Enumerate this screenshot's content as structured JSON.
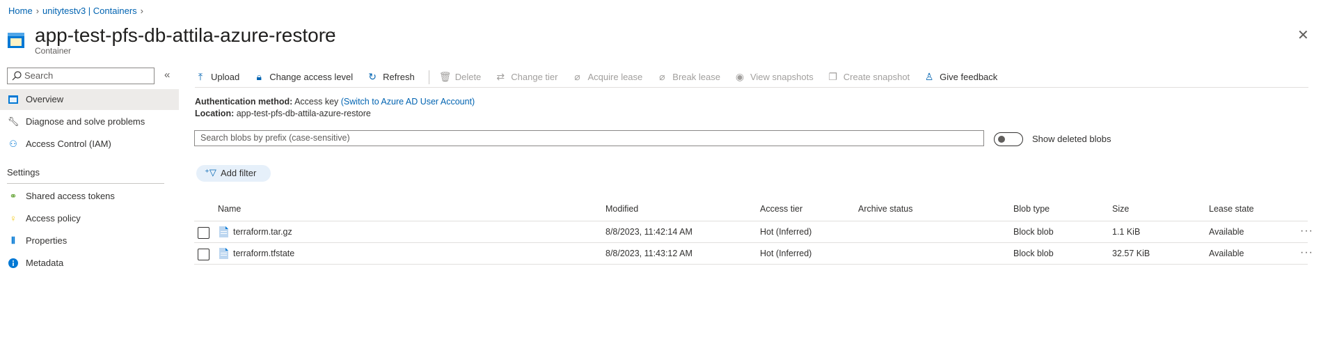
{
  "breadcrumb": [
    "Home",
    "unitytestv3 | Containers"
  ],
  "header": {
    "title": "app-test-pfs-db-attila-azure-restore",
    "subtitle": "Container",
    "more": "···",
    "close": "✕"
  },
  "sidebar": {
    "search_placeholder": "Search",
    "collapse": "«",
    "items": [
      {
        "label": "Overview",
        "icon": "container-icon"
      },
      {
        "label": "Diagnose and solve problems",
        "icon": "wrench-icon"
      },
      {
        "label": "Access Control (IAM)",
        "icon": "people-icon"
      }
    ],
    "settings_title": "Settings",
    "settings_items": [
      {
        "label": "Shared access tokens",
        "icon": "link-icon"
      },
      {
        "label": "Access policy",
        "icon": "key-icon"
      },
      {
        "label": "Properties",
        "icon": "properties-icon"
      },
      {
        "label": "Metadata",
        "icon": "info-icon"
      }
    ]
  },
  "toolbar": {
    "upload": "Upload",
    "change_access": "Change access level",
    "refresh": "Refresh",
    "delete": "Delete",
    "change_tier": "Change tier",
    "acquire_lease": "Acquire lease",
    "break_lease": "Break lease",
    "view_snapshots": "View snapshots",
    "create_snapshot": "Create snapshot",
    "feedback": "Give feedback"
  },
  "info": {
    "auth_label": "Authentication method:",
    "auth_value": "Access key",
    "auth_link": "(Switch to Azure AD User Account)",
    "location_label": "Location:",
    "location_value": "app-test-pfs-db-attila-azure-restore"
  },
  "blob_search_placeholder": "Search blobs by prefix (case-sensitive)",
  "show_deleted": {
    "label": "Show deleted blobs",
    "on": false
  },
  "add_filter": "Add filter",
  "table": {
    "columns": [
      "Name",
      "Modified",
      "Access tier",
      "Archive status",
      "Blob type",
      "Size",
      "Lease state"
    ],
    "rows": [
      {
        "name": "terraform.tar.gz",
        "modified": "8/8/2023, 11:42:14 AM",
        "tier": "Hot (Inferred)",
        "archive": "",
        "type": "Block blob",
        "size": "1.1 KiB",
        "lease": "Available"
      },
      {
        "name": "terraform.tfstate",
        "modified": "8/8/2023, 11:43:12 AM",
        "tier": "Hot (Inferred)",
        "archive": "",
        "type": "Block blob",
        "size": "32.57 KiB",
        "lease": "Available"
      }
    ]
  },
  "colors": {
    "accent": "#0063b1",
    "active_bg": "#edebe9",
    "filter_bg": "#e6f0fa"
  }
}
